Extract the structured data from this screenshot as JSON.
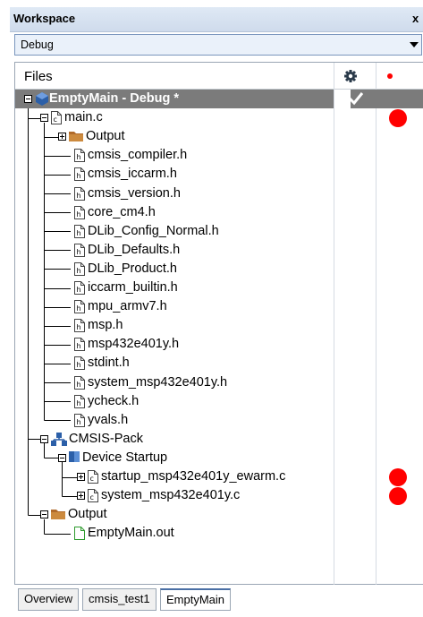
{
  "panel": {
    "title": "Workspace",
    "close_glyph": "x"
  },
  "config_dropdown": {
    "selected": "Debug"
  },
  "header": {
    "files_label": "Files",
    "options_icon": "gear-icon",
    "breakpoint_column_icon": "red-dot-icon"
  },
  "colors": {
    "breakpoint": "#ff0000",
    "selected_row": "#7b7b7b",
    "folder": "#b06a2a",
    "tab_accent": "#4a6fa5"
  },
  "tree": [
    {
      "label": "EmptyMain - Debug *",
      "level": 0,
      "icon": "project-icon",
      "toggle": "minus",
      "selected": true,
      "checked": true,
      "breakpoint": false
    },
    {
      "label": "main.c",
      "level": 1,
      "icon": "c-file-icon",
      "toggle": "minus",
      "breakpoint": true
    },
    {
      "label": "Output",
      "level": 2,
      "icon": "folder-icon",
      "toggle": "plus",
      "breakpoint": false
    },
    {
      "label": "cmsis_compiler.h",
      "level": 2,
      "icon": "h-file-icon",
      "breakpoint": false
    },
    {
      "label": "cmsis_iccarm.h",
      "level": 2,
      "icon": "h-file-icon",
      "breakpoint": false
    },
    {
      "label": "cmsis_version.h",
      "level": 2,
      "icon": "h-file-icon",
      "breakpoint": false
    },
    {
      "label": "core_cm4.h",
      "level": 2,
      "icon": "h-file-icon",
      "breakpoint": false
    },
    {
      "label": "DLib_Config_Normal.h",
      "level": 2,
      "icon": "h-file-icon",
      "breakpoint": false
    },
    {
      "label": "DLib_Defaults.h",
      "level": 2,
      "icon": "h-file-icon",
      "breakpoint": false
    },
    {
      "label": "DLib_Product.h",
      "level": 2,
      "icon": "h-file-icon",
      "breakpoint": false
    },
    {
      "label": "iccarm_builtin.h",
      "level": 2,
      "icon": "h-file-icon",
      "breakpoint": false
    },
    {
      "label": "mpu_armv7.h",
      "level": 2,
      "icon": "h-file-icon",
      "breakpoint": false
    },
    {
      "label": "msp.h",
      "level": 2,
      "icon": "h-file-icon",
      "breakpoint": false
    },
    {
      "label": "msp432e401y.h",
      "level": 2,
      "icon": "h-file-icon",
      "breakpoint": false
    },
    {
      "label": "stdint.h",
      "level": 2,
      "icon": "h-file-icon",
      "breakpoint": false
    },
    {
      "label": "system_msp432e401y.h",
      "level": 2,
      "icon": "h-file-icon",
      "breakpoint": false
    },
    {
      "label": "ycheck.h",
      "level": 2,
      "icon": "h-file-icon",
      "breakpoint": false
    },
    {
      "label": "yvals.h",
      "level": 2,
      "icon": "h-file-icon",
      "breakpoint": false
    },
    {
      "label": "CMSIS-Pack",
      "level": 1,
      "icon": "pack-icon",
      "toggle": "minus",
      "breakpoint": false
    },
    {
      "label": "Device Startup",
      "level": 2,
      "icon": "component-icon",
      "toggle": "minus",
      "breakpoint": false
    },
    {
      "label": "startup_msp432e401y_ewarm.c",
      "level": 3,
      "icon": "c-file-icon",
      "toggle": "plus",
      "breakpoint": true
    },
    {
      "label": "system_msp432e401y.c",
      "level": 3,
      "icon": "c-file-icon",
      "toggle": "plus",
      "breakpoint": true
    },
    {
      "label": "Output",
      "level": 1,
      "icon": "folder-icon",
      "toggle": "minus",
      "breakpoint": false
    },
    {
      "label": "EmptyMain.out",
      "level": 2,
      "icon": "out-file-icon",
      "breakpoint": false
    }
  ],
  "tabs": [
    {
      "label": "Overview",
      "active": false
    },
    {
      "label": "cmsis_test1",
      "active": false
    },
    {
      "label": "EmptyMain",
      "active": true
    }
  ]
}
